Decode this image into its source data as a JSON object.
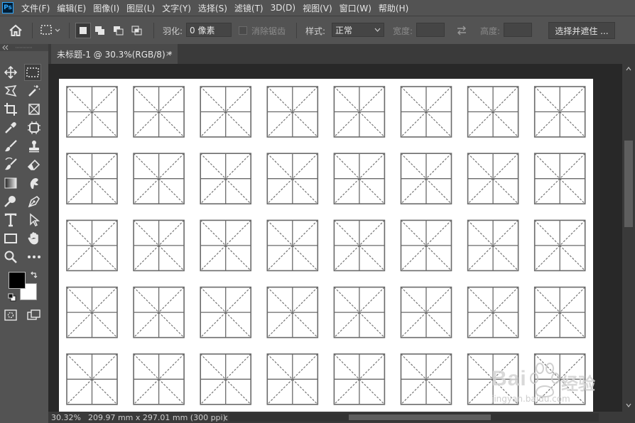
{
  "app": {
    "logo": "Ps"
  },
  "menu": [
    "文件(F)",
    "编辑(E)",
    "图像(I)",
    "图层(L)",
    "文字(Y)",
    "选择(S)",
    "滤镜(T)",
    "3D(D)",
    "视图(V)",
    "窗口(W)",
    "帮助(H)"
  ],
  "options": {
    "feather_label": "羽化:",
    "feather_value": "0 像素",
    "antialias_label": "消除锯齿",
    "style_label": "样式:",
    "style_value": "正常",
    "width_label": "宽度:",
    "height_label": "高度:",
    "select_mask_button": "选择并遮住 ..."
  },
  "document": {
    "tab_title": "未标题-1 @ 30.3%(RGB/8) *",
    "close_glyph": "×",
    "grid_rows": 5,
    "grid_cols": 8
  },
  "status": {
    "zoom": "30.32%",
    "doc_info": "209.97 mm x 297.01 mm (300 ppi)",
    "arrow": ">"
  },
  "colors": {
    "ui_bg": "#535353",
    "canvas_bg": "#282828",
    "foreground": "#000000",
    "background": "#ffffff",
    "accent": "#31a8ff"
  },
  "watermark": {
    "brand": "Bai",
    "brand_cn": "经验",
    "url": "jingyan.baidu.com"
  },
  "icons": [
    "home-icon",
    "marquee-icon",
    "move-icon",
    "lasso-icon",
    "magic-wand-icon",
    "crop-icon",
    "frame-icon",
    "eyedropper-icon",
    "patch-icon",
    "brush-icon",
    "stamp-icon",
    "history-brush-icon",
    "eraser-icon",
    "gradient-icon",
    "smudge-icon",
    "dodge-icon",
    "pen-icon",
    "type-icon",
    "path-select-icon",
    "rectangle-icon",
    "hand-icon",
    "zoom-icon",
    "more-icon",
    "quick-mask-icon",
    "screen-mode-icon"
  ]
}
